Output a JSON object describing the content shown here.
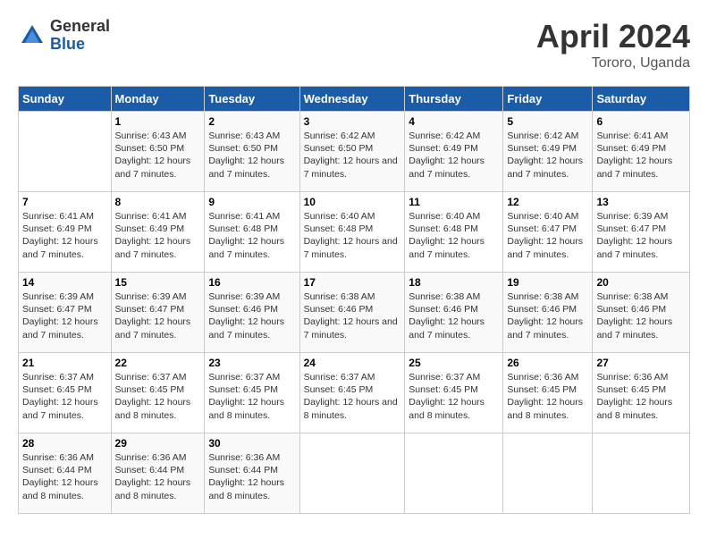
{
  "header": {
    "logo_general": "General",
    "logo_blue": "Blue",
    "title": "April 2024",
    "subtitle": "Tororo, Uganda"
  },
  "days_of_week": [
    "Sunday",
    "Monday",
    "Tuesday",
    "Wednesday",
    "Thursday",
    "Friday",
    "Saturday"
  ],
  "weeks": [
    [
      {
        "day": "",
        "info": ""
      },
      {
        "day": "1",
        "info": "Sunrise: 6:43 AM\nSunset: 6:50 PM\nDaylight: 12 hours and 7 minutes."
      },
      {
        "day": "2",
        "info": "Sunrise: 6:43 AM\nSunset: 6:50 PM\nDaylight: 12 hours and 7 minutes."
      },
      {
        "day": "3",
        "info": "Sunrise: 6:42 AM\nSunset: 6:50 PM\nDaylight: 12 hours and 7 minutes."
      },
      {
        "day": "4",
        "info": "Sunrise: 6:42 AM\nSunset: 6:49 PM\nDaylight: 12 hours and 7 minutes."
      },
      {
        "day": "5",
        "info": "Sunrise: 6:42 AM\nSunset: 6:49 PM\nDaylight: 12 hours and 7 minutes."
      },
      {
        "day": "6",
        "info": "Sunrise: 6:41 AM\nSunset: 6:49 PM\nDaylight: 12 hours and 7 minutes."
      }
    ],
    [
      {
        "day": "7",
        "info": "Sunrise: 6:41 AM\nSunset: 6:49 PM\nDaylight: 12 hours and 7 minutes."
      },
      {
        "day": "8",
        "info": "Sunrise: 6:41 AM\nSunset: 6:49 PM\nDaylight: 12 hours and 7 minutes."
      },
      {
        "day": "9",
        "info": "Sunrise: 6:41 AM\nSunset: 6:48 PM\nDaylight: 12 hours and 7 minutes."
      },
      {
        "day": "10",
        "info": "Sunrise: 6:40 AM\nSunset: 6:48 PM\nDaylight: 12 hours and 7 minutes."
      },
      {
        "day": "11",
        "info": "Sunrise: 6:40 AM\nSunset: 6:48 PM\nDaylight: 12 hours and 7 minutes."
      },
      {
        "day": "12",
        "info": "Sunrise: 6:40 AM\nSunset: 6:47 PM\nDaylight: 12 hours and 7 minutes."
      },
      {
        "day": "13",
        "info": "Sunrise: 6:39 AM\nSunset: 6:47 PM\nDaylight: 12 hours and 7 minutes."
      }
    ],
    [
      {
        "day": "14",
        "info": "Sunrise: 6:39 AM\nSunset: 6:47 PM\nDaylight: 12 hours and 7 minutes."
      },
      {
        "day": "15",
        "info": "Sunrise: 6:39 AM\nSunset: 6:47 PM\nDaylight: 12 hours and 7 minutes."
      },
      {
        "day": "16",
        "info": "Sunrise: 6:39 AM\nSunset: 6:46 PM\nDaylight: 12 hours and 7 minutes."
      },
      {
        "day": "17",
        "info": "Sunrise: 6:38 AM\nSunset: 6:46 PM\nDaylight: 12 hours and 7 minutes."
      },
      {
        "day": "18",
        "info": "Sunrise: 6:38 AM\nSunset: 6:46 PM\nDaylight: 12 hours and 7 minutes."
      },
      {
        "day": "19",
        "info": "Sunrise: 6:38 AM\nSunset: 6:46 PM\nDaylight: 12 hours and 7 minutes."
      },
      {
        "day": "20",
        "info": "Sunrise: 6:38 AM\nSunset: 6:46 PM\nDaylight: 12 hours and 7 minutes."
      }
    ],
    [
      {
        "day": "21",
        "info": "Sunrise: 6:37 AM\nSunset: 6:45 PM\nDaylight: 12 hours and 7 minutes."
      },
      {
        "day": "22",
        "info": "Sunrise: 6:37 AM\nSunset: 6:45 PM\nDaylight: 12 hours and 8 minutes."
      },
      {
        "day": "23",
        "info": "Sunrise: 6:37 AM\nSunset: 6:45 PM\nDaylight: 12 hours and 8 minutes."
      },
      {
        "day": "24",
        "info": "Sunrise: 6:37 AM\nSunset: 6:45 PM\nDaylight: 12 hours and 8 minutes."
      },
      {
        "day": "25",
        "info": "Sunrise: 6:37 AM\nSunset: 6:45 PM\nDaylight: 12 hours and 8 minutes."
      },
      {
        "day": "26",
        "info": "Sunrise: 6:36 AM\nSunset: 6:45 PM\nDaylight: 12 hours and 8 minutes."
      },
      {
        "day": "27",
        "info": "Sunrise: 6:36 AM\nSunset: 6:45 PM\nDaylight: 12 hours and 8 minutes."
      }
    ],
    [
      {
        "day": "28",
        "info": "Sunrise: 6:36 AM\nSunset: 6:44 PM\nDaylight: 12 hours and 8 minutes."
      },
      {
        "day": "29",
        "info": "Sunrise: 6:36 AM\nSunset: 6:44 PM\nDaylight: 12 hours and 8 minutes."
      },
      {
        "day": "30",
        "info": "Sunrise: 6:36 AM\nSunset: 6:44 PM\nDaylight: 12 hours and 8 minutes."
      },
      {
        "day": "",
        "info": ""
      },
      {
        "day": "",
        "info": ""
      },
      {
        "day": "",
        "info": ""
      },
      {
        "day": "",
        "info": ""
      }
    ]
  ]
}
